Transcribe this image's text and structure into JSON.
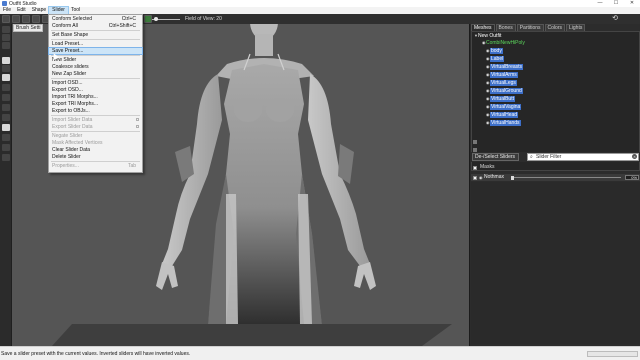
{
  "window": {
    "title": "Outfit Studio",
    "controls": [
      "—",
      "☐",
      "✕"
    ]
  },
  "menubar": {
    "items": [
      "File",
      "Edit",
      "Shape",
      "Slider",
      "Tool"
    ],
    "active": "Slider"
  },
  "toolbar": {
    "field_of_view_label": "Field of View: 20"
  },
  "brush_tab": {
    "label": "Brush Setti"
  },
  "slider_menu": {
    "items": [
      {
        "label": "Conform Selected",
        "shortcut": "Ctrl+C",
        "enabled": true
      },
      {
        "label": "Conform All",
        "shortcut": "Ctrl+Shift+C",
        "enabled": true
      },
      {
        "separator": true
      },
      {
        "label": "Set Base Shape",
        "shortcut": "",
        "enabled": true
      },
      {
        "separator": true
      },
      {
        "label": "Load Preset...",
        "shortcut": "",
        "enabled": true
      },
      {
        "label": "Save Preset...",
        "shortcut": "",
        "enabled": true,
        "highlighted": true
      },
      {
        "separator": true
      },
      {
        "label": "New Slider",
        "shortcut": "",
        "enabled": true
      },
      {
        "label": "Coalesce sliders",
        "shortcut": "",
        "enabled": true
      },
      {
        "label": "New Zap Slider",
        "shortcut": "",
        "enabled": true
      },
      {
        "separator": true
      },
      {
        "label": "Import OSD...",
        "shortcut": "",
        "enabled": true
      },
      {
        "label": "Export OSD...",
        "shortcut": "",
        "enabled": true
      },
      {
        "label": "Import TRI Morphs...",
        "shortcut": "",
        "enabled": true
      },
      {
        "label": "Export TRI Morphs...",
        "shortcut": "",
        "enabled": true
      },
      {
        "label": "Export to OBJs...",
        "shortcut": "",
        "enabled": true
      },
      {
        "separator": true
      },
      {
        "label": "Import Slider Data",
        "shortcut": "",
        "enabled": false,
        "checkbox": true
      },
      {
        "label": "Export Slider Data",
        "shortcut": "",
        "enabled": false,
        "checkbox": true
      },
      {
        "separator": true
      },
      {
        "label": "Negate Slider",
        "shortcut": "",
        "enabled": false
      },
      {
        "label": "Mask Affected Vertices",
        "shortcut": "",
        "enabled": false
      },
      {
        "label": "Clear Slider Data",
        "shortcut": "",
        "enabled": true
      },
      {
        "label": "Delete Slider",
        "shortcut": "",
        "enabled": true
      },
      {
        "separator": true
      },
      {
        "label": "Properties...",
        "shortcut": "Tab",
        "enabled": false
      }
    ]
  },
  "right_panel": {
    "tabs": [
      "Meshes",
      "Bones",
      "Partitions",
      "Colors",
      "Lights"
    ],
    "active_tab": "Meshes",
    "tree": {
      "root": "New Outfit",
      "children": [
        {
          "label": "CombiNewHiPoly",
          "style": "green"
        },
        {
          "label": "body",
          "style": "sel"
        },
        {
          "label": "Label",
          "style": "sel"
        },
        {
          "label": "VirtualBreasts",
          "style": "sel"
        },
        {
          "label": "VirtualArms",
          "style": "sel"
        },
        {
          "label": "VirtualLegs",
          "style": "sel"
        },
        {
          "label": "VirtualGround",
          "style": "sel"
        },
        {
          "label": "VirtualButt",
          "style": "sel"
        },
        {
          "label": "VirtualVagina",
          "style": "sel"
        },
        {
          "label": "VirtualHead",
          "style": "sel"
        },
        {
          "label": "VirtualHands",
          "style": "sel"
        }
      ]
    },
    "deselect_button": "De-/Select Sliders",
    "slider_filter_placeholder": "Slider Filter",
    "masks_label": "Masks",
    "sliders": [
      {
        "name": "Nothmax",
        "value": "0%"
      }
    ]
  },
  "statusbar": {
    "message": "Save a slider preset with the current values. Inverted sliders will have inverted values."
  },
  "colors": {
    "viewport_bg": "#555555",
    "selection": "#3d6fc9",
    "menu_highlight": "#cce4f7"
  }
}
